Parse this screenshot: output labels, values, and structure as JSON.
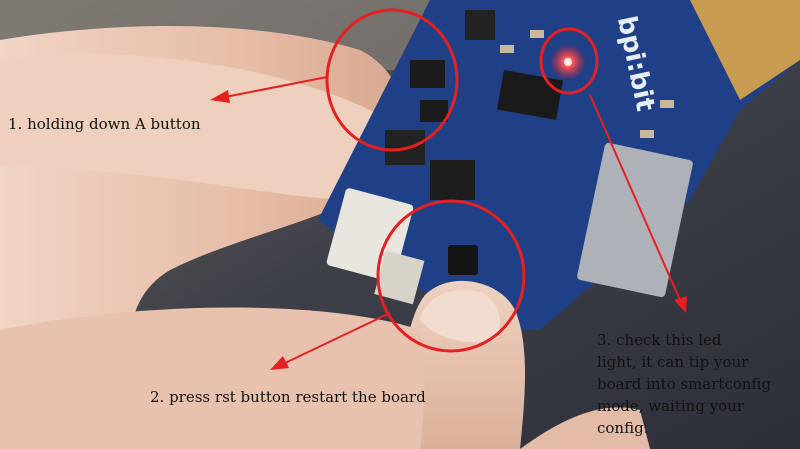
{
  "annotations": {
    "step1": "1. holding down A button",
    "step2": "2. press rst button restart the board",
    "step3_lines": [
      "3. check this led",
      "light, it can tip your",
      "board into smartconfig",
      "mode, waiting your",
      "config."
    ]
  },
  "board": {
    "silkscreen": "bpi:bit"
  },
  "colors": {
    "annotation": "#e62020",
    "led": "#ff3030",
    "pcb": "#1f3f86",
    "skin": "#e9c6b3"
  }
}
